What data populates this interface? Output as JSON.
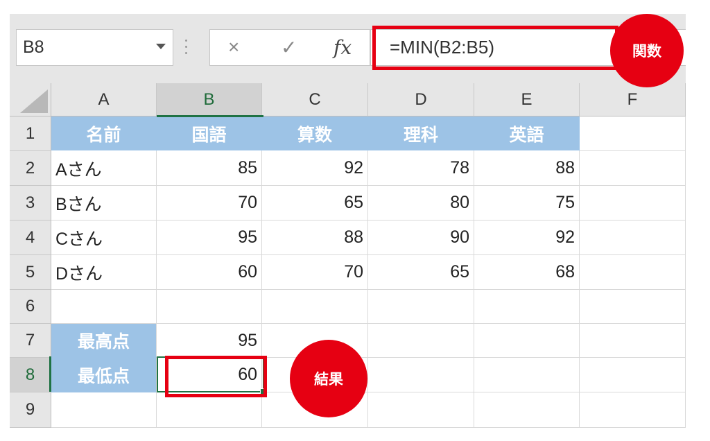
{
  "name_box": {
    "value": "B8"
  },
  "formula_bar": {
    "cancel_glyph": "×",
    "enter_glyph": "✓",
    "fx_label": "fx",
    "formula": "=MIN(B2:B5)"
  },
  "callouts": {
    "function": "関数",
    "result": "結果"
  },
  "columns": [
    "A",
    "B",
    "C",
    "D",
    "E",
    "F"
  ],
  "rows": [
    "1",
    "2",
    "3",
    "4",
    "5",
    "6",
    "7",
    "8",
    "9"
  ],
  "table": {
    "headers": [
      "名前",
      "国語",
      "算数",
      "理科",
      "英語"
    ],
    "data": [
      [
        "Aさん",
        "85",
        "92",
        "78",
        "88"
      ],
      [
        "Bさん",
        "70",
        "65",
        "80",
        "75"
      ],
      [
        "Cさん",
        "95",
        "88",
        "90",
        "92"
      ],
      [
        "Dさん",
        "60",
        "70",
        "65",
        "68"
      ]
    ]
  },
  "summary": {
    "max_label": "最高点",
    "max_value": "95",
    "min_label": "最低点",
    "min_value": "60"
  },
  "colors": {
    "accent_red": "#e60012",
    "header_blue": "#9dc3e6",
    "selection_green": "#1f7244"
  }
}
